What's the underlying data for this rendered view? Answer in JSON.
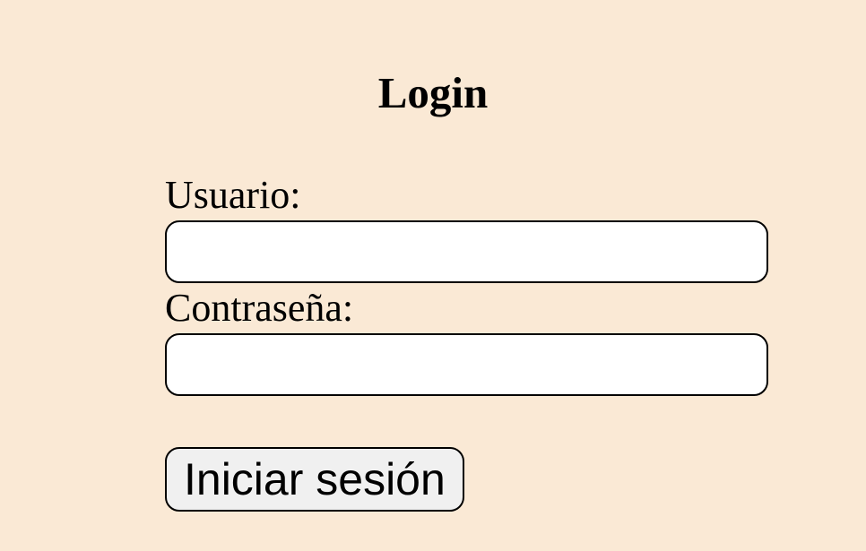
{
  "page": {
    "title": "Login",
    "background_color": "#fae9d5"
  },
  "form": {
    "username_label": "Usuario:",
    "username_value": "",
    "password_label": "Contraseña:",
    "password_value": "",
    "submit_label": "Iniciar sesión"
  }
}
